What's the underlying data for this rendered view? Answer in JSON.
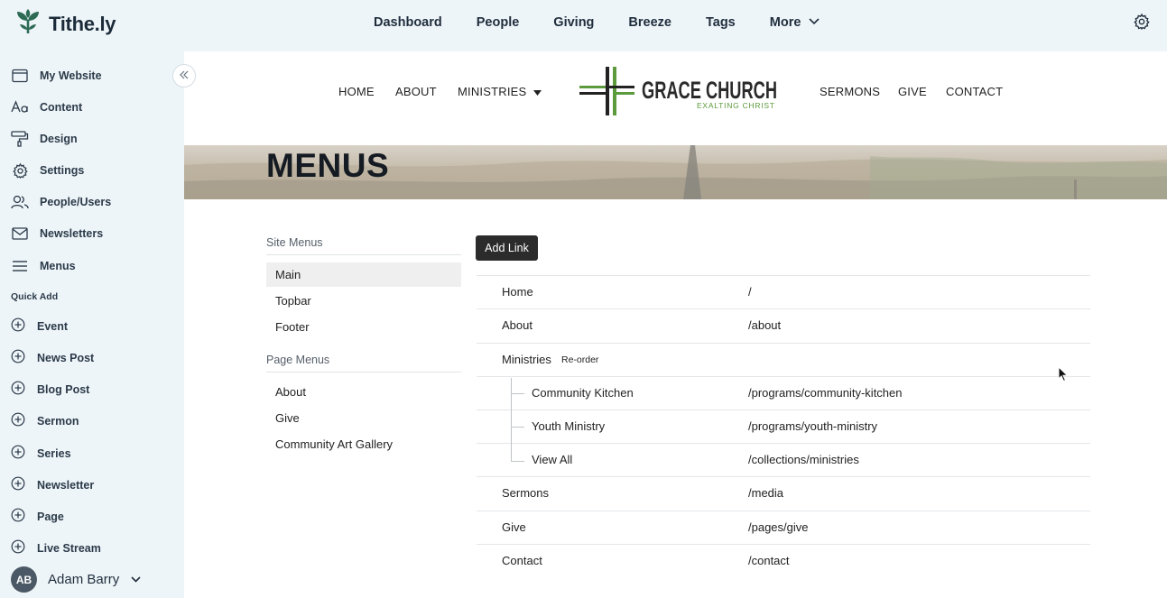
{
  "app": {
    "brand": "Tithe.ly"
  },
  "topnav": [
    {
      "label": "Dashboard"
    },
    {
      "label": "People"
    },
    {
      "label": "Giving"
    },
    {
      "label": "Breeze"
    },
    {
      "label": "Tags"
    },
    {
      "label": "More"
    }
  ],
  "sidebar": {
    "items": [
      {
        "label": "My Website",
        "icon": "browser-window-icon"
      },
      {
        "label": "Content",
        "icon": "text-format-icon"
      },
      {
        "label": "Design",
        "icon": "paint-roller-icon"
      },
      {
        "label": "Settings",
        "icon": "gear-icon"
      },
      {
        "label": "People/Users",
        "icon": "users-icon"
      },
      {
        "label": "Newsletters",
        "icon": "envelope-icon"
      },
      {
        "label": "Menus",
        "icon": "hamburger-menu-icon"
      }
    ],
    "quick_add_label": "Quick Add",
    "quick_add": [
      {
        "label": "Event"
      },
      {
        "label": "News Post"
      },
      {
        "label": "Blog Post"
      },
      {
        "label": "Sermon"
      },
      {
        "label": "Series"
      },
      {
        "label": "Newsletter"
      },
      {
        "label": "Page"
      },
      {
        "label": "Live Stream"
      }
    ],
    "user": {
      "initials": "AB",
      "name": "Adam Barry"
    }
  },
  "site": {
    "nav": [
      "HOME",
      "ABOUT",
      "MINISTRIES",
      "SERMONS",
      "GIVE",
      "CONTACT"
    ],
    "logo": {
      "title": "GRACE CHURCH",
      "tagline": "EXALTING CHRIST"
    },
    "hero_title": "MENUS"
  },
  "menus": {
    "site_menus_label": "Site Menus",
    "site_menus": [
      "Main",
      "Topbar",
      "Footer"
    ],
    "active": "Main",
    "page_menus_label": "Page Menus",
    "page_menus": [
      "About",
      "Give",
      "Community Art Gallery"
    ],
    "add_link_label": "Add Link",
    "reorder_label": "Re-order",
    "links": [
      {
        "name": "Home",
        "url": "/"
      },
      {
        "name": "About",
        "url": "/about"
      },
      {
        "name": "Ministries",
        "url": ""
      },
      {
        "name": "Community Kitchen",
        "url": "/programs/community-kitchen"
      },
      {
        "name": "Youth Ministry",
        "url": "/programs/youth-ministry"
      },
      {
        "name": "View All",
        "url": "/collections/ministries"
      },
      {
        "name": "Sermons",
        "url": "/media"
      },
      {
        "name": "Give",
        "url": "/pages/give"
      },
      {
        "name": "Contact",
        "url": "/contact"
      }
    ]
  },
  "colors": {
    "sidebar_bg": "#eef5f8",
    "brand_dark": "#1c2b39",
    "logo_green": "#5c9a3c",
    "button_dark": "#2b2b2b"
  }
}
